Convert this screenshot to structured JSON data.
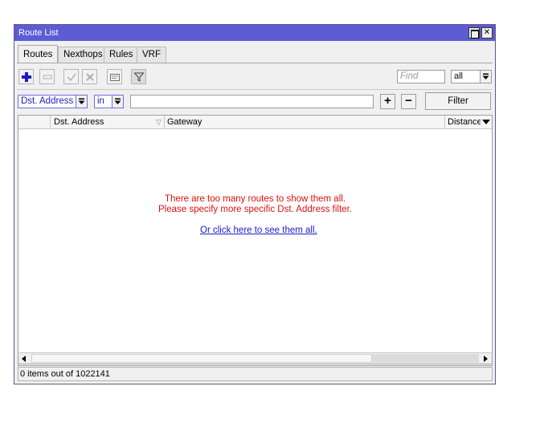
{
  "window": {
    "title": "Route List",
    "close_glyph": "✕"
  },
  "tabs": [
    {
      "label": "Routes",
      "active": true
    },
    {
      "label": "Nexthops",
      "active": false
    },
    {
      "label": "Rules",
      "active": false
    },
    {
      "label": "VRF",
      "active": false
    }
  ],
  "toolbar": {
    "icons": [
      "add-icon",
      "remove-icon",
      "enable-icon",
      "disable-icon",
      "comment-icon",
      "filter-icon"
    ],
    "find_placeholder": "Find",
    "scope_value": "all"
  },
  "filter_bar": {
    "field": "Dst. Address",
    "operator": "in",
    "value": "",
    "add_label": "+",
    "remove_label": "−",
    "filter_button": "Filter"
  },
  "table": {
    "columns": [
      "",
      "Dst. Address",
      "Gateway",
      "Distance"
    ],
    "sort_glyph": "▽",
    "message_line1": "There are too many routes to show them all.",
    "message_line2": "Please specify more specific Dst. Address filter.",
    "see_all_link": "Or click here to see them all."
  },
  "status": {
    "text": "0 items out of 1022141"
  },
  "colors": {
    "title_bar": "#5c5cd4",
    "add_icon": "#1a1acc",
    "message": "#e01010",
    "link": "#1a1acc"
  }
}
